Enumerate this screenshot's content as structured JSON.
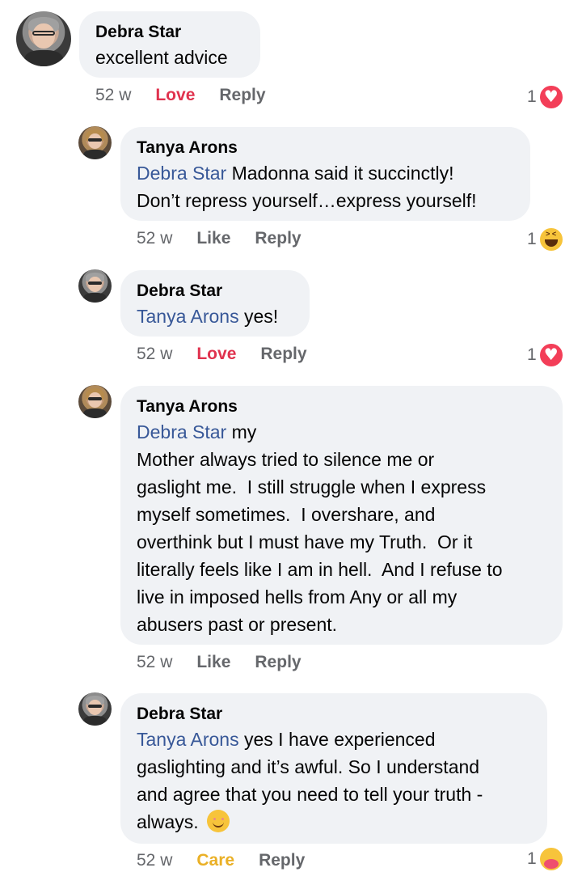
{
  "comments": [
    {
      "author": "Debra Star",
      "mention": "",
      "text": "excellent advice",
      "time": "52 w",
      "action": "Love",
      "reply": "Reply",
      "reaction_count": "1",
      "reaction_icon": "heart-icon"
    },
    {
      "author": "Tanya Arons",
      "mention": "Debra Star",
      "text": " Madonna said it succinctly!\nDon’t repress yourself…express yourself!",
      "time": "52 w",
      "action": "Like",
      "reply": "Reply",
      "reaction_count": "1",
      "reaction_icon": "haha-icon"
    },
    {
      "author": "Debra Star",
      "mention": "Tanya Arons",
      "text": " yes!",
      "time": "52 w",
      "action": "Love",
      "reply": "Reply",
      "reaction_count": "1",
      "reaction_icon": "heart-icon"
    },
    {
      "author": "Tanya Arons",
      "mention": "Debra Star",
      "text": " my\nMother always tried to silence me or\ngaslight me.  I still struggle when I express\nmyself sometimes.  I overshare, and\noverthink but I must have my Truth.  Or it\nliterally feels like I am in hell.  And I refuse to\nlive in imposed hells from Any or all my\nabusers past or present.",
      "time": "52 w",
      "action": "Like",
      "reply": "Reply"
    },
    {
      "author": "Debra Star",
      "mention": "Tanya Arons",
      "text": " yes I have experienced\ngaslighting and it’s awful. So I understand\nand agree that you need to tell your truth -\nalways. ",
      "time": "52 w",
      "action": "Care",
      "reply": "Reply",
      "reaction_count": "1",
      "reaction_icon": "care-icon"
    }
  ]
}
